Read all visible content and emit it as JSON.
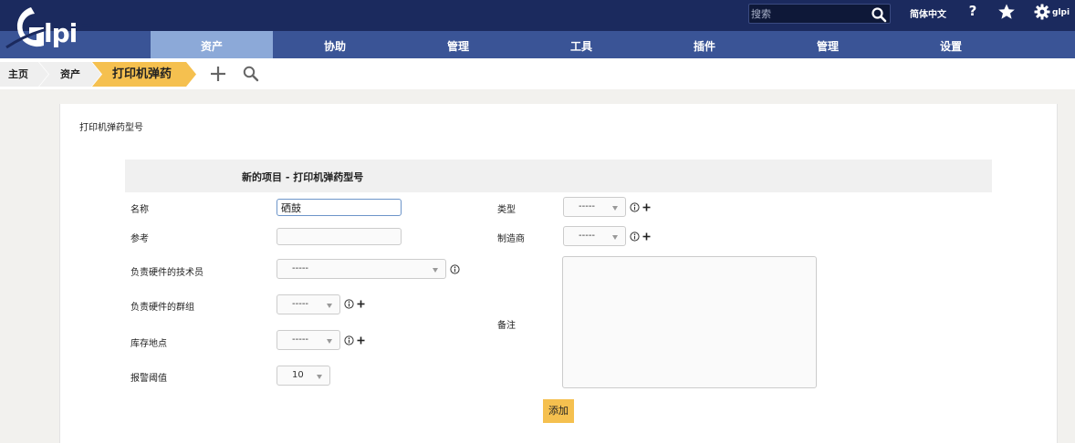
{
  "header": {
    "logo_text": "Glpi",
    "search_placeholder": "搜索",
    "language": "简体中文",
    "help": "?",
    "user": "glpi"
  },
  "menu": {
    "items": [
      "资产",
      "协助",
      "管理",
      "工具",
      "插件",
      "管理",
      "设置"
    ],
    "active": "资产"
  },
  "breadcrumb": {
    "home": "主页",
    "assets": "资产",
    "current": "打印机弹药"
  },
  "page": {
    "heading": "打印机弹药型号",
    "form_title": "新的项目 - 打印机弹药型号"
  },
  "form": {
    "name_label": "名称",
    "name_value": "硒鼓",
    "ref_label": "参考",
    "ref_value": "",
    "tech_label": "负责硬件的技术员",
    "tech_value": "-----",
    "group_label": "负责硬件的群组",
    "group_value": "-----",
    "location_label": "库存地点",
    "location_value": "-----",
    "alarm_label": "报警阈值",
    "alarm_value": "10",
    "type_label": "类型",
    "type_value": "-----",
    "manufacturer_label": "制造商",
    "manufacturer_value": "-----",
    "notes_label": "备注",
    "notes_value": "",
    "submit_label": "添加"
  },
  "colors": {
    "header_bg": "#1b2a5e",
    "menu_bg": "#3a5496",
    "menu_active": "#8ca9d8",
    "breadcrumb_active": "#f5c04f",
    "submit_bg": "#f5c04f"
  }
}
